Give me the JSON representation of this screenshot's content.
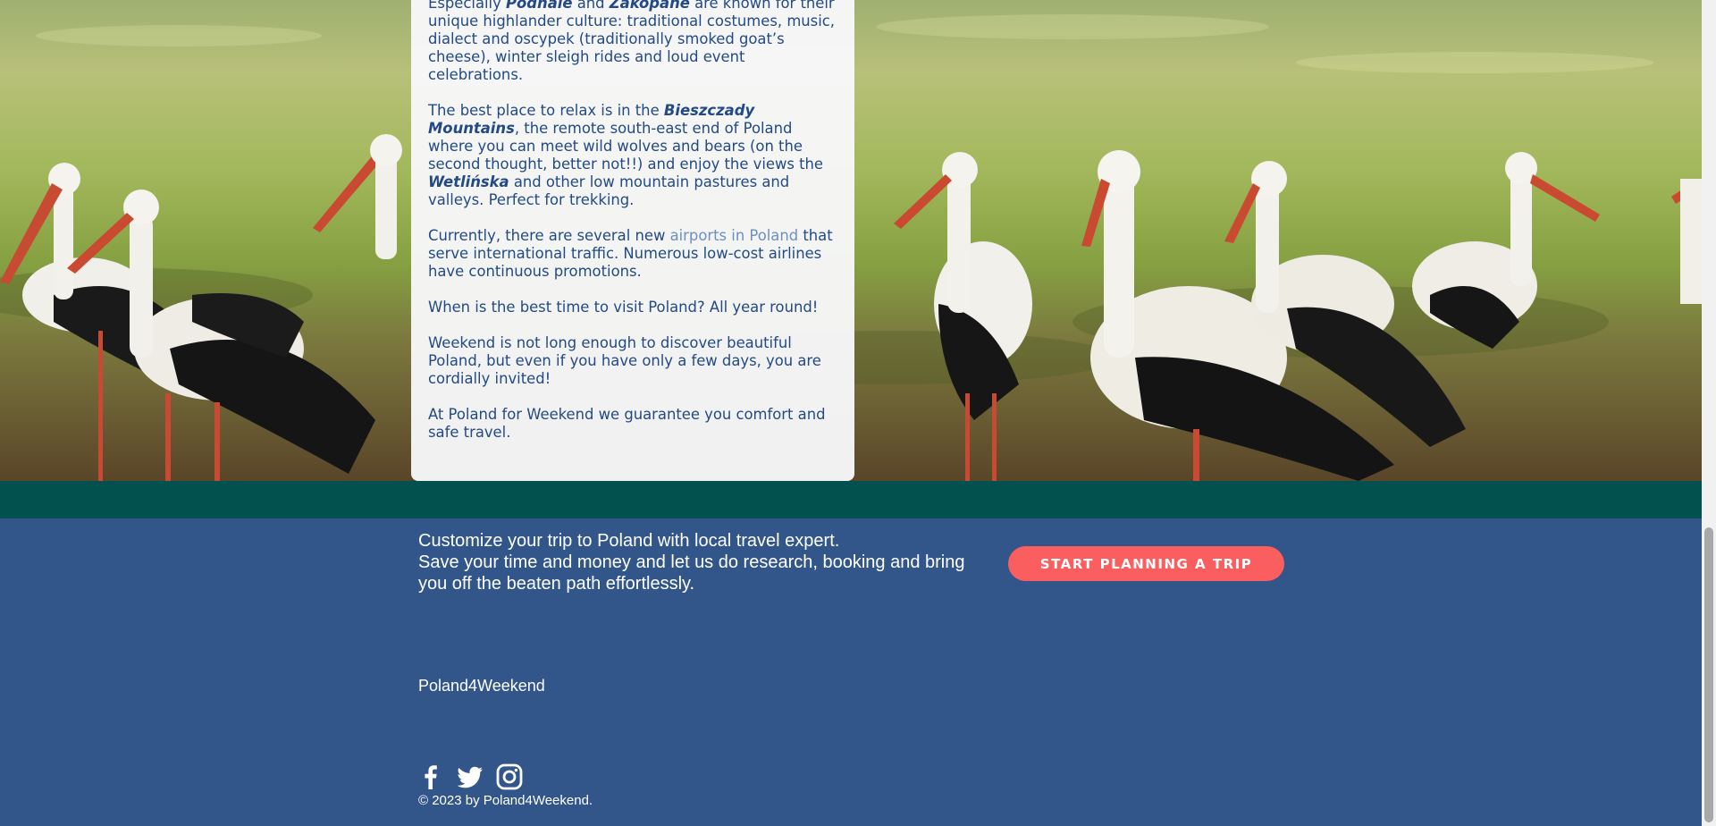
{
  "article": {
    "paragraphs": [
      {
        "segments": [
          {
            "text": "Especially ",
            "style": "normal"
          },
          {
            "text": "Podhale",
            "style": "highlight"
          },
          {
            "text": " and ",
            "style": "normal"
          },
          {
            "text": "Zakopane",
            "style": "highlight"
          },
          {
            "text": " are known for their unique highlander culture: traditional costumes, music, dialect and oscypek (traditionally smoked goat’s cheese), winter sleigh rides and loud event celebrations.",
            "style": "normal"
          }
        ]
      },
      {
        "segments": [
          {
            "text": "The best place to relax is in the ",
            "style": "normal"
          },
          {
            "text": "Bieszczady Mountains",
            "style": "highlight"
          },
          {
            "text": ", the remote south-east end of Poland where you can meet wild wolves and bears (on the second thought, better not!!) and enjoy the views the ",
            "style": "normal"
          },
          {
            "text": "Wetlińska",
            "style": "highlight"
          },
          {
            "text": " and other low mountain pastures and valleys. Perfect for trekking.",
            "style": "normal"
          }
        ]
      },
      {
        "segments": [
          {
            "text": "Currently, there are several new ",
            "style": "normal"
          },
          {
            "text": "airports in Poland",
            "style": "link"
          },
          {
            "text": " that serve international traffic. Numerous low-cost airlines have continuous promotions.",
            "style": "normal"
          }
        ]
      },
      {
        "segments": [
          {
            "text": "When is the best time to visit Poland? All year round!",
            "style": "normal"
          }
        ]
      },
      {
        "segments": [
          {
            "text": "Weekend is not long enough to discover beautiful Poland, but even if you have only a few days, you are cordially invited!",
            "style": "normal"
          }
        ]
      },
      {
        "segments": [
          {
            "text": "At Poland for Weekend we guarantee you comfort and safe travel.",
            "style": "normal"
          }
        ]
      }
    ]
  },
  "cta": {
    "line1": "Customize your trip to Poland with local travel expert.",
    "line2": "Save your time and money and let us do research, booking and bring you off the beaten path effortlessly.",
    "button_label": "START PLANNING A TRIP"
  },
  "footer": {
    "brand": "Poland4Weekend",
    "social": [
      "facebook-icon",
      "twitter-icon",
      "instagram-icon"
    ],
    "copyright": "© 2023 by Poland4Weekend."
  },
  "colors": {
    "card_text": "#234a86",
    "link": "#6f8ec2",
    "teal_strip": "#03514f",
    "footer_bg": "#32558a",
    "cta_button": "#fa5e5e"
  }
}
